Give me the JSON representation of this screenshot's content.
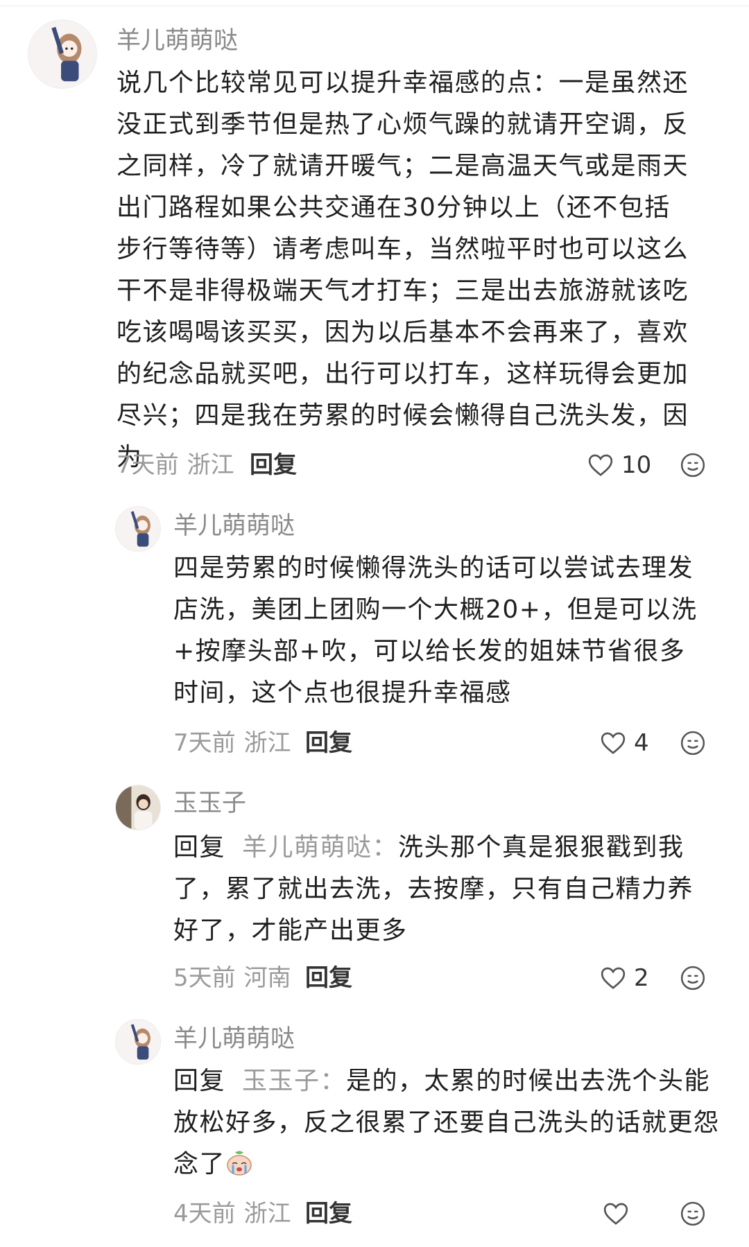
{
  "comments": [
    {
      "user": "羊儿萌萌哒",
      "text": "说几个比较常见可以提升幸福感的点：一是虽然还没正式到季节但是热了心烦气躁的就请开空调，反之同样，冷了就请开暖气；二是高温天气或是雨天出门路程如果公共交通在30分钟以上（还不包括步行等待等）请考虑叫车，当然啦平时也可以这么干不是非得极端天气才打车；三是出去旅游就该吃吃该喝喝该买买，因为以后基本不会再来了，喜欢的纪念品就买吧，出行可以打车，这样玩得会更加尽兴；四是我在劳累的时候会懒得自己洗头发，因为",
      "time": "7天前",
      "location": "浙江",
      "reply_label": "回复",
      "likes": "10"
    },
    {
      "user": "羊儿萌萌哒",
      "text": "四是劳累的时候懒得洗头的话可以尝试去理发店洗，美团上团购一个大概20+，但是可以洗+按摩头部+吹，可以给长发的姐妹节省很多时间，这个点也很提升幸福感",
      "time": "7天前",
      "location": "浙江",
      "reply_label": "回复",
      "likes": "4"
    },
    {
      "user": "玉玉子",
      "reply_prefix": "回复",
      "reply_to": "羊儿萌萌哒：",
      "text": "洗头那个真是狠狠戳到我了，累了就出去洗，去按摩，只有自己精力养好了，才能产出更多",
      "time": "5天前",
      "location": "河南",
      "reply_label": "回复",
      "likes": "2"
    },
    {
      "user": "羊儿萌萌哒",
      "reply_prefix": "回复",
      "reply_to": "玉玉子：",
      "text": "是的，太累的时候出去洗个头能放松好多，反之很累了还要自己洗头的话就更怨念了",
      "time": "4天前",
      "location": "浙江",
      "reply_label": "回复",
      "likes": ""
    }
  ],
  "icons": {
    "like": "heart-outline-icon",
    "emoji": "smiley-icon",
    "sticker": "crying-sticker"
  },
  "colors": {
    "text": "#1f1f1f",
    "muted": "#9a9a9a",
    "action": "#333333"
  }
}
